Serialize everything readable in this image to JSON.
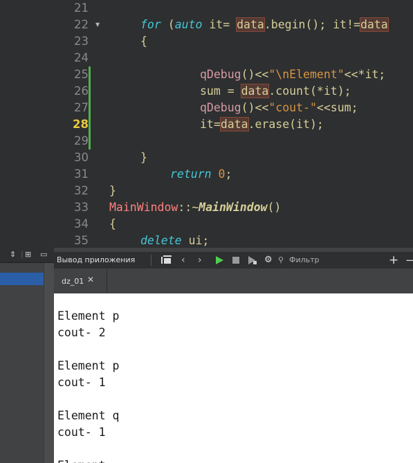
{
  "editor": {
    "line_numbers": [
      "21",
      "22",
      "23",
      "24",
      "25",
      "26",
      "27",
      "28",
      "29",
      "30",
      "31",
      "32",
      "33",
      "34",
      "35"
    ],
    "current_line": "28",
    "lines": {
      "l22": {
        "kw_for": "for",
        "p1": " (",
        "kw_auto": "auto",
        "p2": " it= ",
        "data": "data",
        "p3": ".begin(); it!=",
        "data2": "data"
      },
      "l23": {
        "brace": "{"
      },
      "l25": {
        "fn": "qDebug",
        "p1": "()<<",
        "str": "\"\\nElement\"",
        "p2": "<<*it;"
      },
      "l26": {
        "p1": "sum = ",
        "data": "data",
        "p2": ".count(*it);"
      },
      "l27": {
        "fn": "qDebug",
        "p1": "()<<",
        "str": "\"cout-\"",
        "p2": "<<sum;"
      },
      "l28": {
        "p1": "it=",
        "data": "data",
        "p2": ".erase(it);"
      },
      "l30": {
        "brace": "}"
      },
      "l31": {
        "kw": "return",
        "sp": " ",
        "num": "0",
        "semi": ";"
      },
      "l32": {
        "brace": "}"
      },
      "l33": {
        "cls": "MainWindow",
        "p1": "::~",
        "fn": "MainWindow",
        "p2": "()"
      },
      "l34": {
        "brace": "{"
      },
      "l35": {
        "kw": "delete",
        "p1": " ui;"
      }
    }
  },
  "output_toolbar": {
    "title": "Вывод приложения",
    "filter_placeholder": "Фильтр",
    "add": "+",
    "minus": "−"
  },
  "tab": {
    "label": "dz_01"
  },
  "output_lines": [
    "Element p",
    "cout- 2",
    "",
    "Element p",
    "cout- 1",
    "",
    "Element q",
    "cout- 1",
    "",
    "Element"
  ],
  "left_toolbar": {
    "sort_glyph": "⇕",
    "split_glyph": "⊞",
    "close_glyph": "▭"
  }
}
